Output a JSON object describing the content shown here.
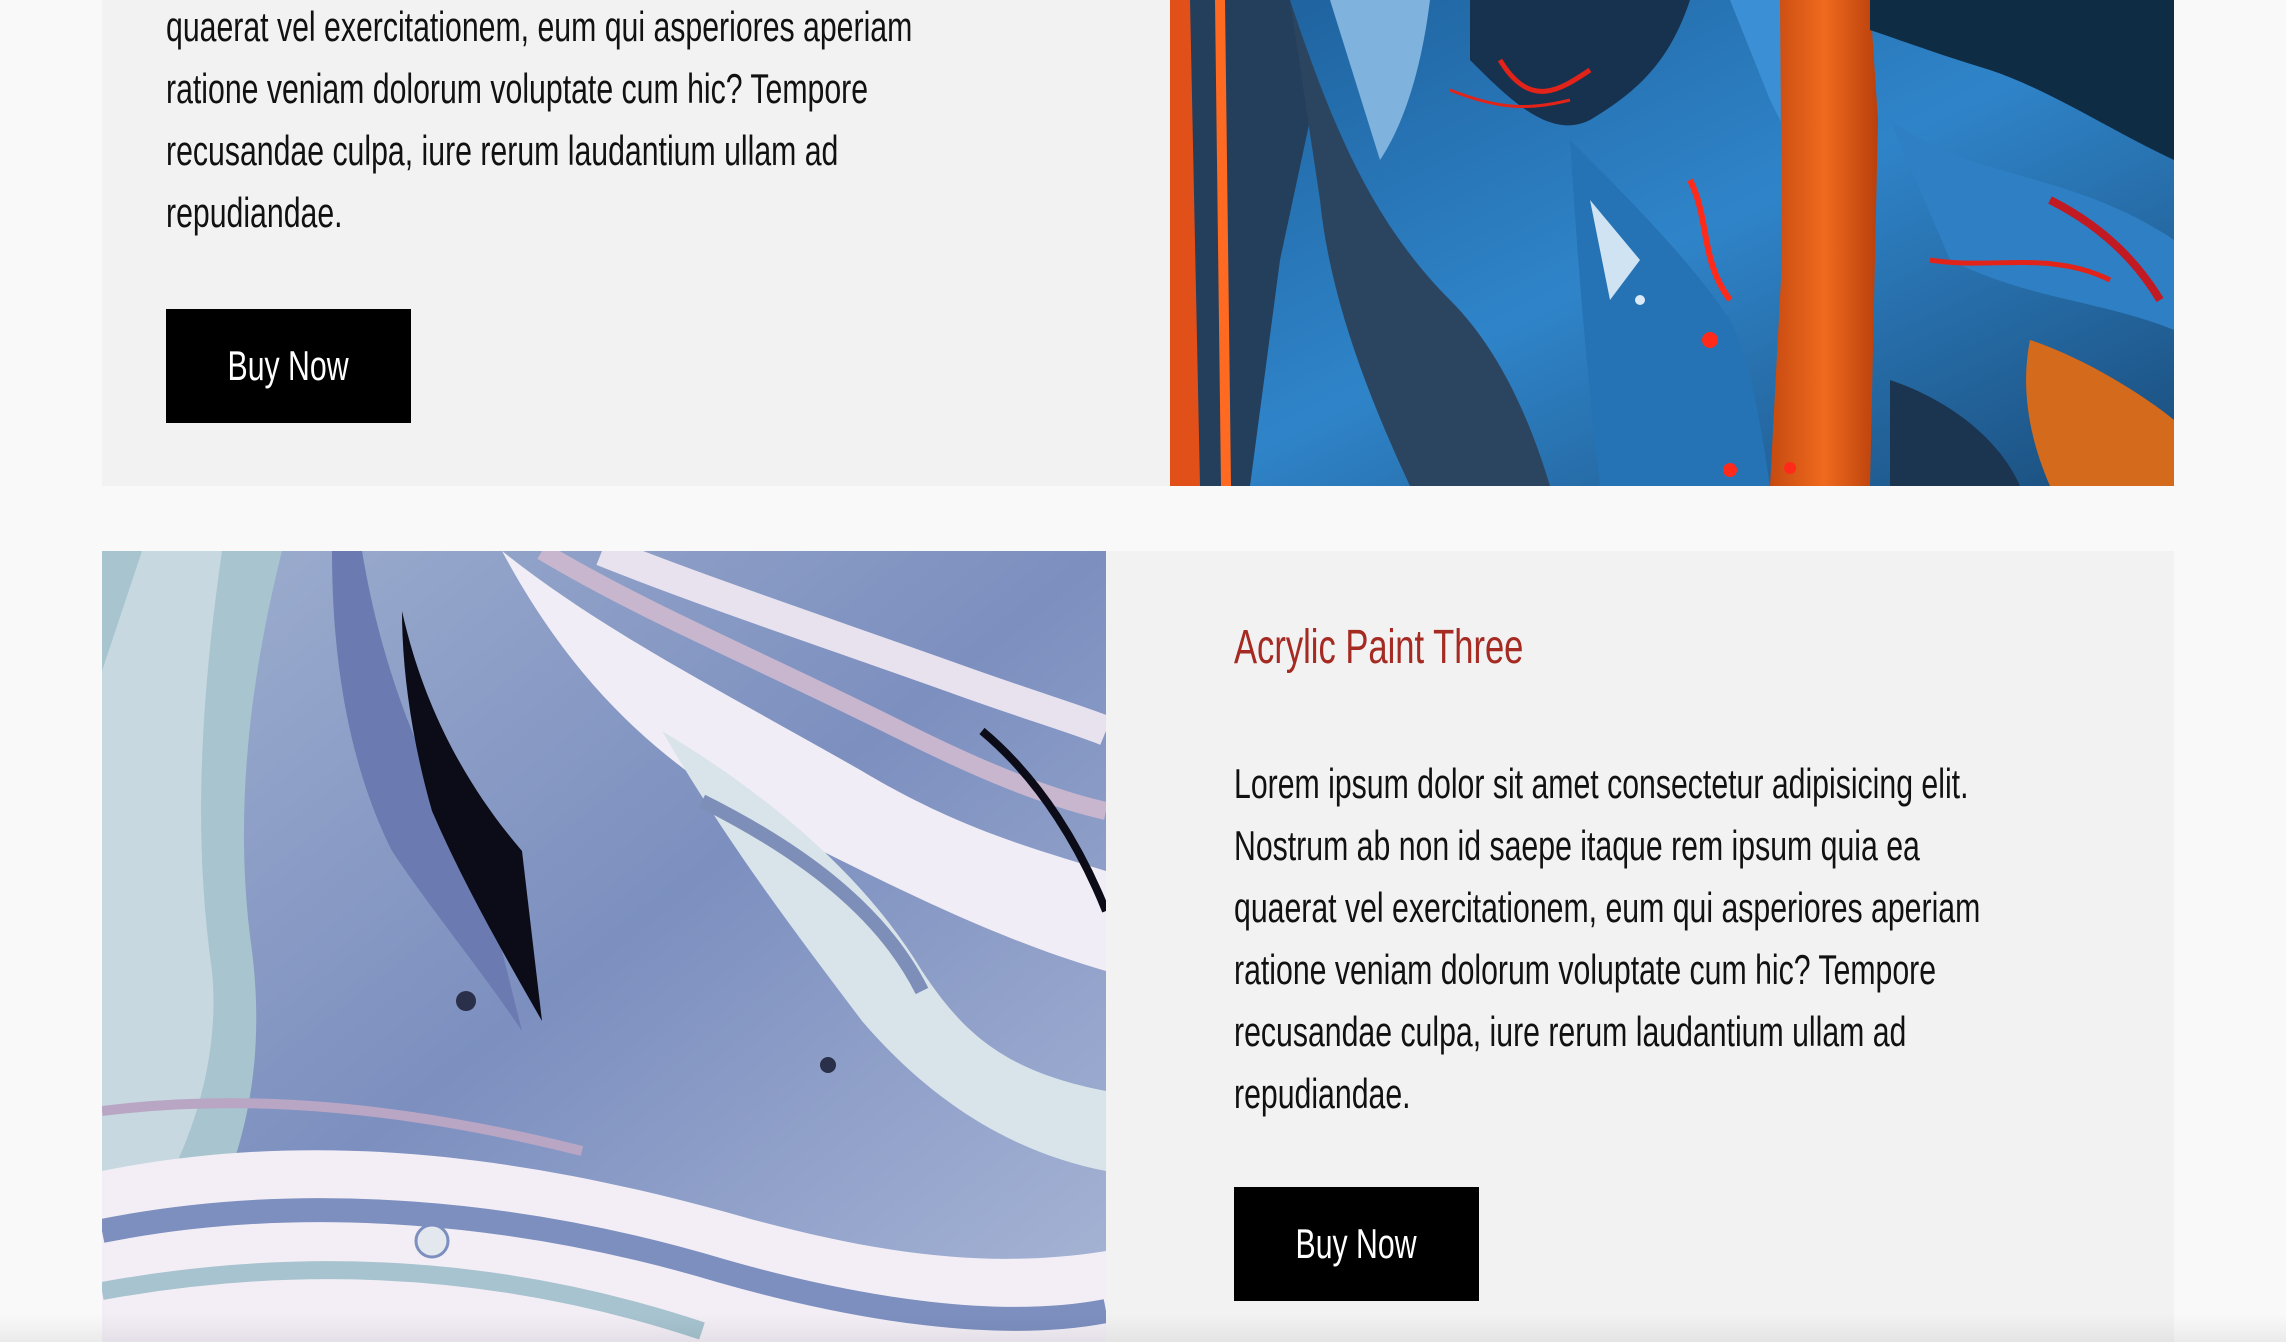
{
  "products": [
    {
      "title": "",
      "description_lines": [
        "quaerat vel exercitationem, eum qui asperiores aperiam",
        "ratione veniam dolorum voluptate cum hic? Tempore",
        "recusandae culpa, iure rerum laudantium ullam ad",
        "repudiandae."
      ],
      "button_label": "Buy Now",
      "image": "abstract-painting-blue-orange-image"
    },
    {
      "title": "Acrylic Paint Three",
      "description_lines": [
        "Lorem ipsum dolor sit amet consectetur adipisicing elit.",
        "Nostrum ab non id saepe itaque rem ipsum quia ea",
        "quaerat vel exercitationem, eum qui asperiores aperiam",
        "ratione veniam dolorum voluptate cum hic? Tempore",
        "recusandae culpa, iure rerum laudantium ullam ad",
        "repudiandae."
      ],
      "button_label": "Buy Now",
      "image": "marbled-paint-lavender-image"
    }
  ],
  "colors": {
    "page_background": "#f9f9f9",
    "card_background": "#f2f2f2",
    "title_color": "#a52a22",
    "button_background": "#000000",
    "button_text": "#ffffff"
  }
}
